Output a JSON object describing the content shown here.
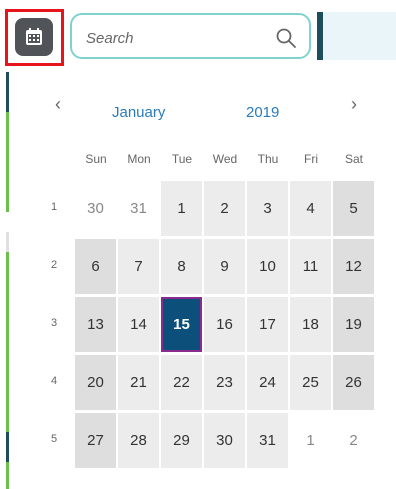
{
  "search": {
    "placeholder": "Search",
    "value": ""
  },
  "calendar": {
    "nav": {
      "prev": "‹",
      "next": "›",
      "month": "January",
      "year": "2019"
    },
    "weekdays": [
      "Sun",
      "Mon",
      "Tue",
      "Wed",
      "Thu",
      "Fri",
      "Sat"
    ],
    "weeks": [
      {
        "num": "1",
        "days": [
          "30",
          "31",
          "1",
          "2",
          "3",
          "4",
          "5"
        ]
      },
      {
        "num": "2",
        "days": [
          "6",
          "7",
          "8",
          "9",
          "10",
          "11",
          "12"
        ]
      },
      {
        "num": "3",
        "days": [
          "13",
          "14",
          "15",
          "16",
          "17",
          "18",
          "19"
        ]
      },
      {
        "num": "4",
        "days": [
          "20",
          "21",
          "22",
          "23",
          "24",
          "25",
          "26"
        ]
      },
      {
        "num": "5",
        "days": [
          "27",
          "28",
          "29",
          "30",
          "31",
          "1",
          "2"
        ]
      }
    ],
    "selected": "15"
  },
  "colors": {
    "accent": "#2a7bbd",
    "selected_bg": "#0b4f7a",
    "highlight_border": "#e8141c",
    "search_border": "#7fd3cf"
  },
  "icons": {
    "calendar_button": "calendar-icon",
    "search": "search-icon"
  }
}
